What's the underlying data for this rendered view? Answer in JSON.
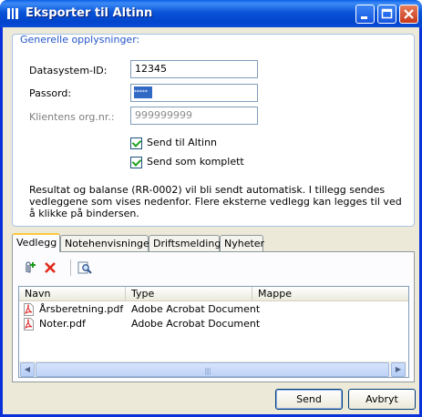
{
  "window": {
    "title": "Eksporter til Altinn"
  },
  "group": {
    "title": "Generelle opplysninger:",
    "fields": {
      "system_id_label": "Datasystem-ID:",
      "system_id_value": "12345",
      "password_label": "Passord:",
      "password_value": "*****",
      "orgnr_label": "Klientens org.nr.:",
      "orgnr_value": "999999999"
    },
    "checkboxes": {
      "send_altinn": "Send til Altinn",
      "send_complete": "Send som komplett"
    },
    "info": "Resultat og balanse (RR-0002) vil bli sendt automatisk. I tillegg sendes vedleggene som vises nedenfor. Flere eksterne vedlegg kan legges til ved å klikke på bindersen."
  },
  "tabs": [
    "Vedlegg",
    "Notehenvisninger",
    "Driftsmeldinger",
    "Nyheter"
  ],
  "toolbar": {
    "icons": [
      "add-attachment-icon",
      "delete-icon",
      "preview-icon"
    ]
  },
  "list": {
    "columns": [
      "Navn",
      "Type",
      "Mappe"
    ],
    "rows": [
      {
        "name": "Årsberetning.pdf",
        "type": "Adobe Acrobat Document",
        "folder": ""
      },
      {
        "name": "Noter.pdf",
        "type": "Adobe Acrobat Document",
        "folder": ""
      }
    ]
  },
  "buttons": {
    "send": "Send",
    "cancel": "Avbryt"
  },
  "colors": {
    "titlebar": "#0a54d8",
    "group_title": "#2456c8",
    "selection": "#316ac5"
  }
}
